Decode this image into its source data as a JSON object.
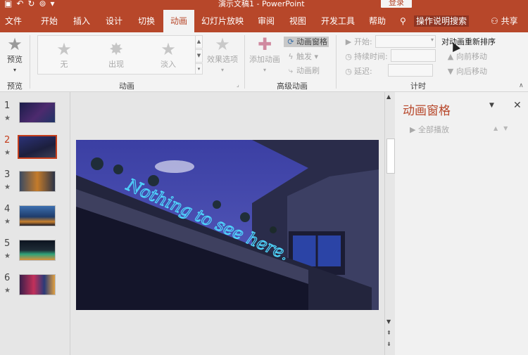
{
  "window": {
    "title": "演示文稿1 - PowerPoint",
    "login_label": "登录",
    "qat_icons": [
      "save-icon",
      "undo-icon",
      "redo-icon",
      "present-icon",
      "customize-icon"
    ]
  },
  "tabs": [
    {
      "label": "文件"
    },
    {
      "label": "开始"
    },
    {
      "label": "插入"
    },
    {
      "label": "设计"
    },
    {
      "label": "切换"
    },
    {
      "label": "动画",
      "active": true
    },
    {
      "label": "幻灯片放映"
    },
    {
      "label": "审阅"
    },
    {
      "label": "视图"
    },
    {
      "label": "开发工具"
    },
    {
      "label": "帮助"
    }
  ],
  "tell_me": "操作说明搜索",
  "share": "共享",
  "ribbon": {
    "preview": {
      "button": "预览",
      "group": "预览"
    },
    "animation": {
      "group": "动画",
      "gallery": [
        {
          "label": "无"
        },
        {
          "label": "出现"
        },
        {
          "label": "淡入"
        }
      ],
      "effect_options": "效果选项"
    },
    "advanced": {
      "group": "高级动画",
      "add_animation": "添加动画",
      "animation_pane": "动画窗格",
      "trigger": "触发",
      "painter": "动画刷"
    },
    "timing": {
      "group": "计时",
      "start": "开始:",
      "duration": "持续时间:",
      "delay": "延迟:",
      "reorder_title": "对动画重新排序",
      "move_earlier": "向前移动",
      "move_later": "向后移动"
    }
  },
  "thumbnails": [
    {
      "num": "1",
      "star": "★",
      "selected": false
    },
    {
      "num": "2",
      "star": "★",
      "selected": true
    },
    {
      "num": "3",
      "star": "★",
      "selected": false
    },
    {
      "num": "4",
      "star": "★",
      "selected": false
    },
    {
      "num": "5",
      "star": "★",
      "selected": false
    },
    {
      "num": "6",
      "star": "★",
      "selected": false
    }
  ],
  "slide": {
    "neon_text": "Nothing to see here."
  },
  "animation_pane": {
    "title": "动画窗格",
    "play_all": "全部播放"
  },
  "colors": {
    "accent": "#b7472a",
    "selection": "#c43e1c",
    "neon": "#4fd8ff"
  }
}
